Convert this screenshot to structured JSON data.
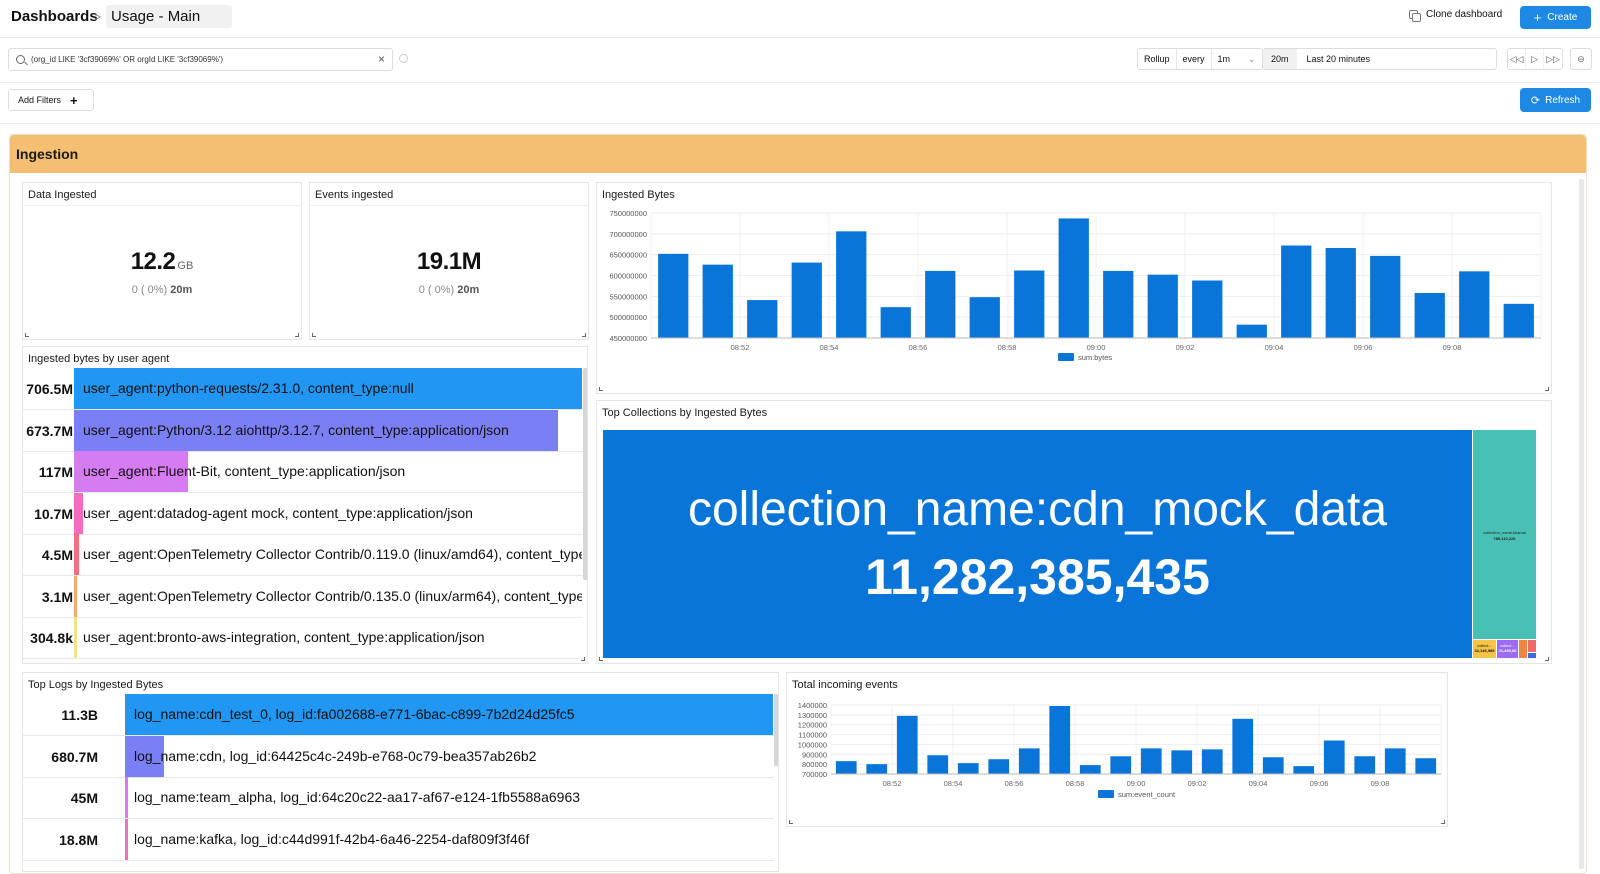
{
  "header": {
    "breadcrumb": "Dashboards",
    "separator": ">",
    "dashboard_title": "Usage - Main",
    "clone_label": "Clone dashboard",
    "create_label": "Create"
  },
  "filters": {
    "query": "(org_id LIKE '3cf39069%' OR orgId LIKE '3cf39069%')",
    "rollup_label": "Rollup",
    "every_label": "every",
    "every_value": "1m",
    "time_short": "20m",
    "time_long": "Last 20 minutes",
    "add_filters_label": "Add Filters",
    "refresh_label": "Refresh"
  },
  "section": {
    "title": "Ingestion"
  },
  "stats": [
    {
      "title": "Data Ingested",
      "value": "12.2",
      "unit": "GB",
      "sub": "0 ( 0%)",
      "period": "20m"
    },
    {
      "title": "Events ingested",
      "value": "19.1M",
      "unit": "",
      "sub": "0 ( 0%)",
      "period": "20m"
    }
  ],
  "user_agent_panel": {
    "title": "Ingested bytes by user agent",
    "rows": [
      {
        "value": "706.5M",
        "label": "user_agent:python-requests/2.31.0, content_type:null",
        "fraction": 1.0,
        "color": "#2196f3"
      },
      {
        "value": "673.7M",
        "label": "user_agent:Python/3.12 aiohttp/3.12.7, content_type:application/json",
        "fraction": 0.953,
        "color": "#7b7ff5"
      },
      {
        "value": "117M",
        "label": "user_agent:Fluent-Bit, content_type:application/json",
        "fraction": 0.224,
        "color": "#d67cf2"
      },
      {
        "value": "10.7M",
        "label": "user_agent:datadog-agent mock, content_type:application/json",
        "fraction": 0.018,
        "color": "#f06dc0"
      },
      {
        "value": "4.5M",
        "label": "user_agent:OpenTelemetry Collector Contrib/0.119.0 (linux/amd64), content_type:application/json",
        "fraction": 0.009,
        "color": "#f2707e"
      },
      {
        "value": "3.1M",
        "label": "user_agent:OpenTelemetry Collector Contrib/0.135.0 (linux/arm64), content_type:application/json",
        "fraction": 0.006,
        "color": "#f7a86e"
      },
      {
        "value": "304.8k",
        "label": "user_agent:bronto-aws-integration, content_type:application/json",
        "fraction": 0.002,
        "color": "#f3e28a"
      }
    ]
  },
  "ingested_bytes_chart": {
    "title": "Ingested Bytes",
    "chart_data": {
      "type": "bar",
      "legend": "sum:bytes",
      "color": "#0a75d8",
      "ylim": [
        450000000,
        750000000
      ],
      "yticks": [
        "750000000",
        "700000000",
        "650000000",
        "600000000",
        "550000000",
        "500000000",
        "450000000"
      ],
      "xticks": [
        "08:52",
        "08:54",
        "08:56",
        "08:58",
        "09:00",
        "09:02",
        "09:04",
        "09:06",
        "09:08"
      ],
      "values": [
        652000000,
        626000000,
        541000000,
        631000000,
        706000000,
        524000000,
        611000000,
        548000000,
        612000000,
        737000000,
        611000000,
        602000000,
        588000000,
        482000000,
        672000000,
        666000000,
        647000000,
        558000000,
        610000000,
        532000000
      ]
    }
  },
  "collections_panel": {
    "title": "Top Collections by Ingested Bytes",
    "main_label": "collection_name:cdn_mock_data",
    "main_value": "11,282,385,435",
    "side_label": "collection_name:kkamai",
    "side_value": "789,110,226",
    "small_a_label": "collect...",
    "small_a_value": "32,146,989",
    "small_b_label": "collect...",
    "small_b_value": "21,459,65"
  },
  "top_logs_panel": {
    "title": "Top Logs by Ingested Bytes",
    "rows": [
      {
        "value": "11.3B",
        "label": "log_name:cdn_test_0, log_id:fa002688-e771-6bac-c899-7b2d24d25fc5",
        "fraction": 1.0,
        "color": "#2196f3"
      },
      {
        "value": "680.7M",
        "label": "log_name:cdn, log_id:64425c4c-249b-e768-0c79-bea357ab26b2",
        "fraction": 0.06,
        "color": "#7b7ff5"
      },
      {
        "value": "45M",
        "label": "log_name:team_alpha, log_id:64c20c22-aa17-af67-e124-1fb5588a6963",
        "fraction": 0.004,
        "color": "#d67cf2"
      },
      {
        "value": "18.8M",
        "label": "log_name:kafka, log_id:c44d991f-42b4-6a46-2254-daf809f3f46f",
        "fraction": 0.002,
        "color": "#f06dc0"
      }
    ]
  },
  "events_chart": {
    "title": "Total incoming events",
    "chart_data": {
      "type": "bar",
      "legend": "sum:event_count",
      "color": "#0a75d8",
      "ylim": [
        700000,
        1400000
      ],
      "yticks": [
        "1400000",
        "1300000",
        "1200000",
        "1100000",
        "1000000",
        "900000",
        "800000",
        "700000"
      ],
      "xticks": [
        "08:52",
        "08:54",
        "08:56",
        "08:58",
        "09:00",
        "09:02",
        "09:04",
        "09:06",
        "09:08"
      ],
      "values": [
        830000,
        800000,
        1290000,
        890000,
        810000,
        850000,
        960000,
        1390000,
        790000,
        880000,
        960000,
        940000,
        950000,
        1260000,
        870000,
        780000,
        1040000,
        880000,
        960000,
        860000
      ]
    }
  }
}
